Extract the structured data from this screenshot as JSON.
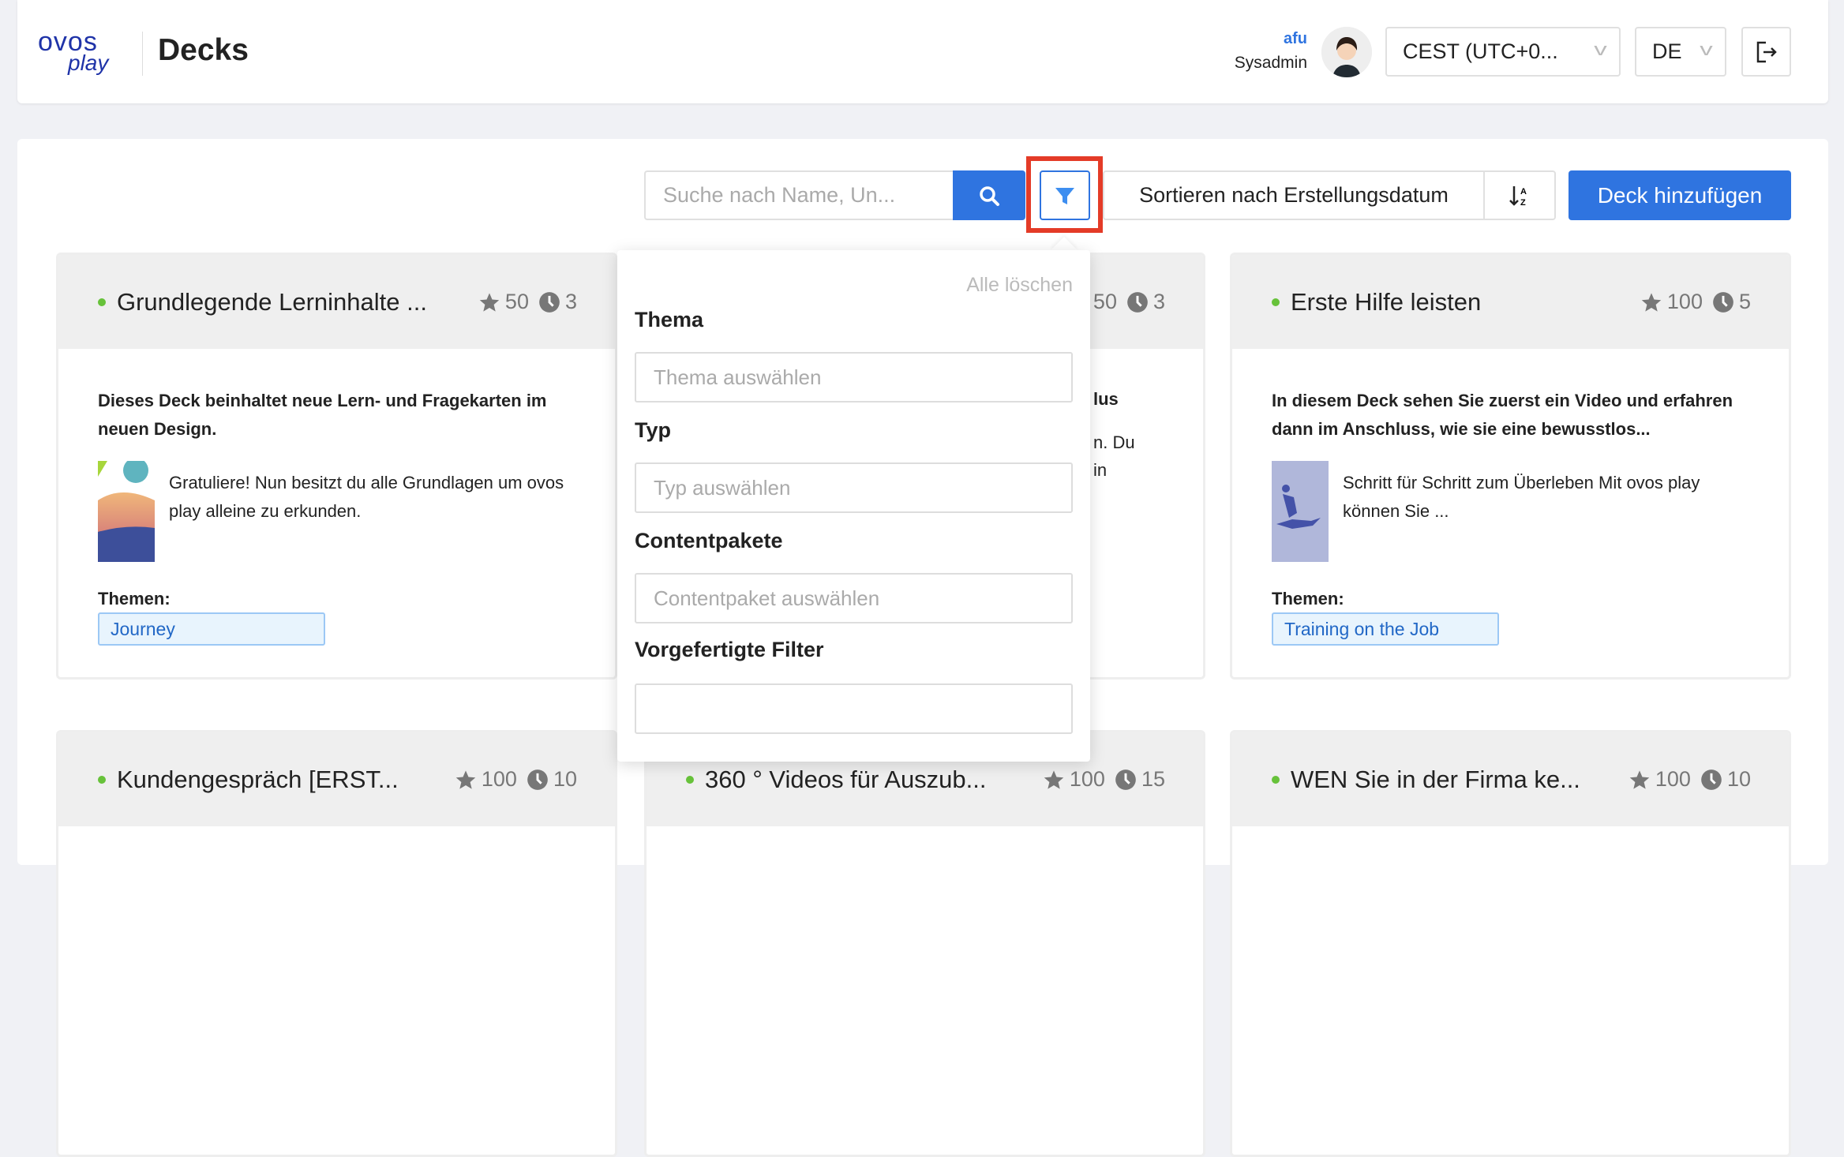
{
  "header": {
    "logo_top": "ovos",
    "logo_bottom": "play",
    "title": "Decks",
    "user": {
      "name": "afu",
      "role": "Sysadmin"
    },
    "timezone": "CEST (UTC+0...",
    "language": "DE",
    "logout_icon": "logout-icon"
  },
  "toolbar": {
    "search_placeholder": "Suche nach Name, Un...",
    "search_icon": "search-icon",
    "filter_icon": "filter-icon",
    "sort_label": "Sortieren nach Erstellungsdatum",
    "sort_dir_icon": "sort-descending-icon",
    "add_deck": "Deck hinzufügen"
  },
  "filter_popup": {
    "clear_all": "Alle löschen",
    "fields": [
      {
        "label": "Thema",
        "placeholder": "Thema auswählen"
      },
      {
        "label": "Typ",
        "placeholder": "Typ auswählen"
      },
      {
        "label": "Contentpakete",
        "placeholder": "Contentpaket auswählen"
      },
      {
        "label": "Vorgefertigte Filter",
        "placeholder": ""
      }
    ]
  },
  "colors": {
    "accent": "#2f74e0",
    "highlight": "#e43b27",
    "status_active": "#67c23a"
  },
  "decks": [
    {
      "title": "Grundlegende Lerninhalte ...",
      "stars": "50",
      "duration": "3",
      "description": "Dieses Deck beinhaltet neue Lern- und Fragekarten im neuen Design.",
      "card_text": "Gratuliere! Nun besitzt du alle Grundlagen um ovos play alleine zu erkunden.",
      "themes_label": "Themen:",
      "theme": "Journey"
    },
    {
      "title": "",
      "stars": "50",
      "duration": "3",
      "fragments": [
        "lus",
        "n. Du",
        "in"
      ]
    },
    {
      "title": "Erste Hilfe leisten",
      "stars": "100",
      "duration": "5",
      "description": "In diesem Deck sehen Sie zuerst ein Video und erfahren dann im Anschluss, wie sie eine bewusstlos...",
      "card_text": "Schritt für Schritt zum Überleben Mit ovos play können Sie ...",
      "themes_label": "Themen:",
      "theme": "Training on the Job"
    },
    {
      "title": "Kundengespräch [ERST...",
      "stars": "100",
      "duration": "10"
    },
    {
      "title": "360 ° Videos für Auszub...",
      "stars": "100",
      "duration": "15"
    },
    {
      "title": "WEN Sie in der Firma ke...",
      "stars": "100",
      "duration": "10"
    }
  ]
}
